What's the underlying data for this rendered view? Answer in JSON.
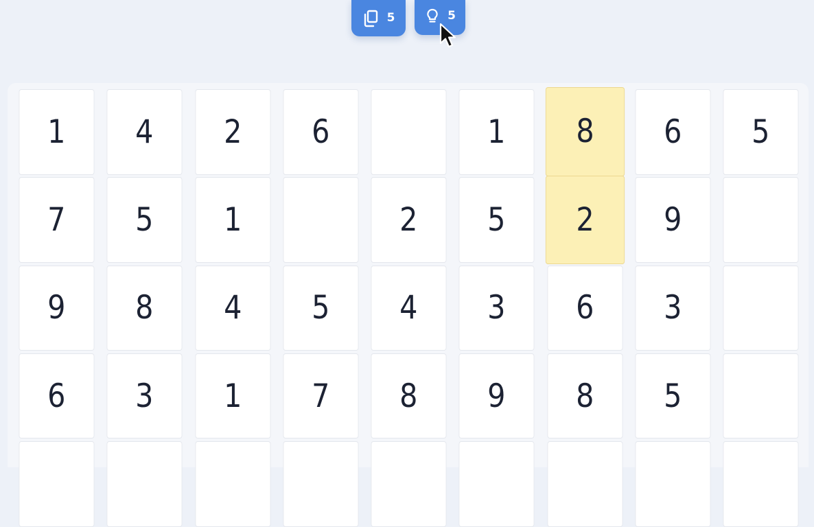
{
  "toolbar": {
    "undo": {
      "icon": "copy-icon",
      "count": "5"
    },
    "hint": {
      "icon": "lightbulb-icon",
      "count": "5"
    }
  },
  "board": {
    "rows": [
      [
        "1",
        "4",
        "2",
        "6",
        "",
        "1",
        "8",
        "6",
        "5"
      ],
      [
        "7",
        "5",
        "1",
        "",
        "2",
        "5",
        "2",
        "9",
        ""
      ],
      [
        "9",
        "8",
        "4",
        "5",
        "4",
        "3",
        "6",
        "3",
        ""
      ],
      [
        "6",
        "3",
        "1",
        "7",
        "8",
        "9",
        "8",
        "5",
        ""
      ],
      [
        "",
        "",
        "",
        "",
        "",
        "",
        "",
        "",
        ""
      ]
    ],
    "selected_cells": [
      [
        0,
        6
      ],
      [
        1,
        6
      ]
    ],
    "colors": {
      "background": "#edf1f8",
      "cell": "#ffffff",
      "selected": "#fcf0b6",
      "button": "#4a86e0",
      "digit": "#1c2233"
    }
  }
}
